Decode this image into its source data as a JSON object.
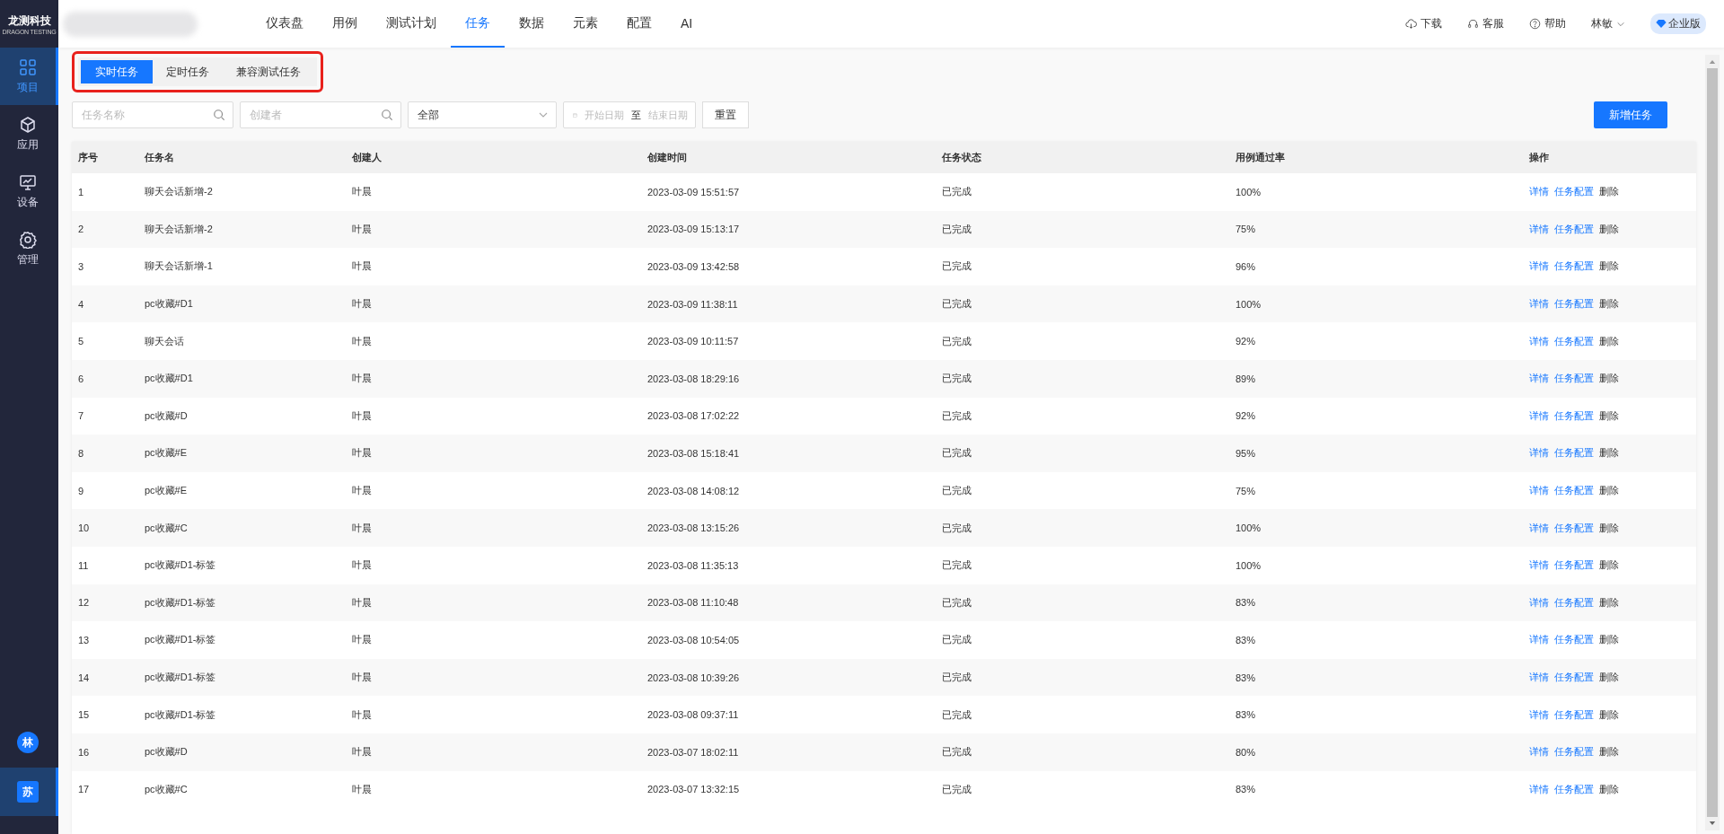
{
  "logo": {
    "title": "龙测科技",
    "subtitle": "DRAGON TESTING"
  },
  "nav": [
    {
      "label": "仪表盘",
      "selected": false
    },
    {
      "label": "用例",
      "selected": false
    },
    {
      "label": "测试计划",
      "selected": false
    },
    {
      "label": "任务",
      "selected": true
    },
    {
      "label": "数据",
      "selected": false
    },
    {
      "label": "元素",
      "selected": false
    },
    {
      "label": "配置",
      "selected": false
    },
    {
      "label": "AI",
      "selected": false
    }
  ],
  "header_actions": [
    "下载",
    "客服",
    "帮助"
  ],
  "user": {
    "name": "林敏"
  },
  "edition_badge": "企业版",
  "sidebar": {
    "items": [
      {
        "label": "项目",
        "selected": true
      },
      {
        "label": "应用",
        "selected": false
      },
      {
        "label": "设备",
        "selected": false
      },
      {
        "label": "管理",
        "selected": false
      }
    ]
  },
  "avatars": [
    {
      "initial": "林",
      "selected": false
    },
    {
      "initial": "苏",
      "selected": true
    }
  ],
  "tabs_highlighted": true,
  "tabs": [
    {
      "label": "实时任务",
      "selected": true
    },
    {
      "label": "定时任务",
      "selected": false
    },
    {
      "label": "兼容测试任务",
      "selected": false
    }
  ],
  "filters": {
    "task_name": {
      "placeholder": "任务名称"
    },
    "creator": {
      "placeholder": "创建者"
    },
    "status_select": {
      "value": "全部"
    },
    "date_range": {
      "start_placeholder": "开始日期",
      "separator": "至",
      "end_placeholder": "结束日期"
    },
    "reset_button": "重置"
  },
  "add_button": "新增任务",
  "table": {
    "columns": [
      "序号",
      "任务名",
      "创建人",
      "创建时间",
      "任务状态",
      "用例通过率",
      "操作"
    ],
    "rows": [
      {
        "no": "1",
        "name": "聊天会话新增-2",
        "creator": "叶晨",
        "created": "2023-03-09 15:51:57",
        "status": "已完成",
        "pass_rate": "100%",
        "actions": [
          "详情",
          "任务配置",
          "删除"
        ]
      },
      {
        "no": "2",
        "name": "聊天会话新增-2",
        "creator": "叶晨",
        "created": "2023-03-09 15:13:17",
        "status": "已完成",
        "pass_rate": "75%",
        "actions": [
          "详情",
          "任务配置",
          "删除"
        ]
      },
      {
        "no": "3",
        "name": "聊天会话新增-1",
        "creator": "叶晨",
        "created": "2023-03-09 13:42:58",
        "status": "已完成",
        "pass_rate": "96%",
        "actions": [
          "详情",
          "任务配置",
          "删除"
        ]
      },
      {
        "no": "4",
        "name": "pc收藏#D1",
        "creator": "叶晨",
        "created": "2023-03-09 11:38:11",
        "status": "已完成",
        "pass_rate": "100%",
        "actions": [
          "详情",
          "任务配置",
          "删除"
        ]
      },
      {
        "no": "5",
        "name": "聊天会话",
        "creator": "叶晨",
        "created": "2023-03-09 10:11:57",
        "status": "已完成",
        "pass_rate": "92%",
        "actions": [
          "详情",
          "任务配置",
          "删除"
        ]
      },
      {
        "no": "6",
        "name": "pc收藏#D1",
        "creator": "叶晨",
        "created": "2023-03-08 18:29:16",
        "status": "已完成",
        "pass_rate": "89%",
        "actions": [
          "详情",
          "任务配置",
          "删除"
        ]
      },
      {
        "no": "7",
        "name": "pc收藏#D",
        "creator": "叶晨",
        "created": "2023-03-08 17:02:22",
        "status": "已完成",
        "pass_rate": "92%",
        "actions": [
          "详情",
          "任务配置",
          "删除"
        ]
      },
      {
        "no": "8",
        "name": "pc收藏#E",
        "creator": "叶晨",
        "created": "2023-03-08 15:18:41",
        "status": "已完成",
        "pass_rate": "95%",
        "actions": [
          "详情",
          "任务配置",
          "删除"
        ]
      },
      {
        "no": "9",
        "name": "pc收藏#E",
        "creator": "叶晨",
        "created": "2023-03-08 14:08:12",
        "status": "已完成",
        "pass_rate": "75%",
        "actions": [
          "详情",
          "任务配置",
          "删除"
        ]
      },
      {
        "no": "10",
        "name": "pc收藏#C",
        "creator": "叶晨",
        "created": "2023-03-08 13:15:26",
        "status": "已完成",
        "pass_rate": "100%",
        "actions": [
          "详情",
          "任务配置",
          "删除"
        ]
      },
      {
        "no": "11",
        "name": "pc收藏#D1-标签",
        "creator": "叶晨",
        "created": "2023-03-08 11:35:13",
        "status": "已完成",
        "pass_rate": "100%",
        "actions": [
          "详情",
          "任务配置",
          "删除"
        ]
      },
      {
        "no": "12",
        "name": "pc收藏#D1-标签",
        "creator": "叶晨",
        "created": "2023-03-08 11:10:48",
        "status": "已完成",
        "pass_rate": "83%",
        "actions": [
          "详情",
          "任务配置",
          "删除"
        ]
      },
      {
        "no": "13",
        "name": "pc收藏#D1-标签",
        "creator": "叶晨",
        "created": "2023-03-08 10:54:05",
        "status": "已完成",
        "pass_rate": "83%",
        "actions": [
          "详情",
          "任务配置",
          "删除"
        ]
      },
      {
        "no": "14",
        "name": "pc收藏#D1-标签",
        "creator": "叶晨",
        "created": "2023-03-08 10:39:26",
        "status": "已完成",
        "pass_rate": "83%",
        "actions": [
          "详情",
          "任务配置",
          "删除"
        ]
      },
      {
        "no": "15",
        "name": "pc收藏#D1-标签",
        "creator": "叶晨",
        "created": "2023-03-08 09:37:11",
        "status": "已完成",
        "pass_rate": "83%",
        "actions": [
          "详情",
          "任务配置",
          "删除"
        ]
      },
      {
        "no": "16",
        "name": "pc收藏#D",
        "creator": "叶晨",
        "created": "2023-03-07 18:02:11",
        "status": "已完成",
        "pass_rate": "80%",
        "actions": [
          "详情",
          "任务配置",
          "删除"
        ]
      },
      {
        "no": "17",
        "name": "pc收藏#C",
        "creator": "叶晨",
        "created": "2023-03-07 13:32:15",
        "status": "已完成",
        "pass_rate": "83%",
        "actions": [
          "详情",
          "任务配置",
          "删除"
        ]
      }
    ]
  }
}
